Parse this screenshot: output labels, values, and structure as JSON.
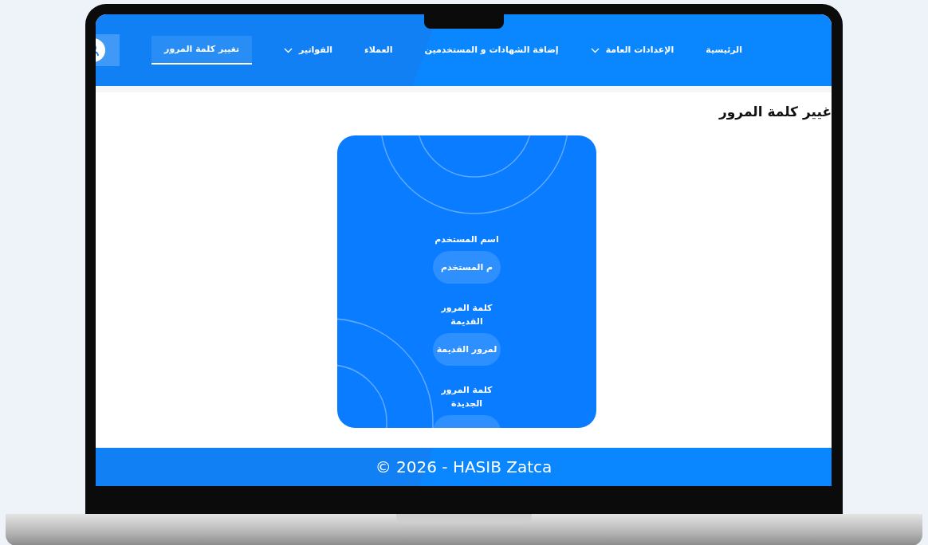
{
  "nav": {
    "items": [
      {
        "label": "الرئيسية",
        "selected": false,
        "dropdown": false
      },
      {
        "label": "الإعدادات العامة",
        "selected": false,
        "dropdown": true
      },
      {
        "label": "إضافة الشهادات و المستخدمين",
        "selected": false,
        "dropdown": false
      },
      {
        "label": "العملاء",
        "selected": false,
        "dropdown": false
      },
      {
        "label": "الفواتير",
        "selected": false,
        "dropdown": true
      },
      {
        "label": "تغيير كلمة المرور",
        "selected": true,
        "dropdown": false
      }
    ]
  },
  "page_title": "غيير كلمة المرور",
  "form": {
    "fields": [
      {
        "label": "اسم المستخدم",
        "placeholder": "م المستخدم"
      },
      {
        "label": "كلمة المرور القديمة",
        "placeholder": "لمرور القديمة"
      },
      {
        "label": "كلمة المرور الجديدة"
      }
    ]
  },
  "footer": "© 2026 - HASIB Zatca"
}
